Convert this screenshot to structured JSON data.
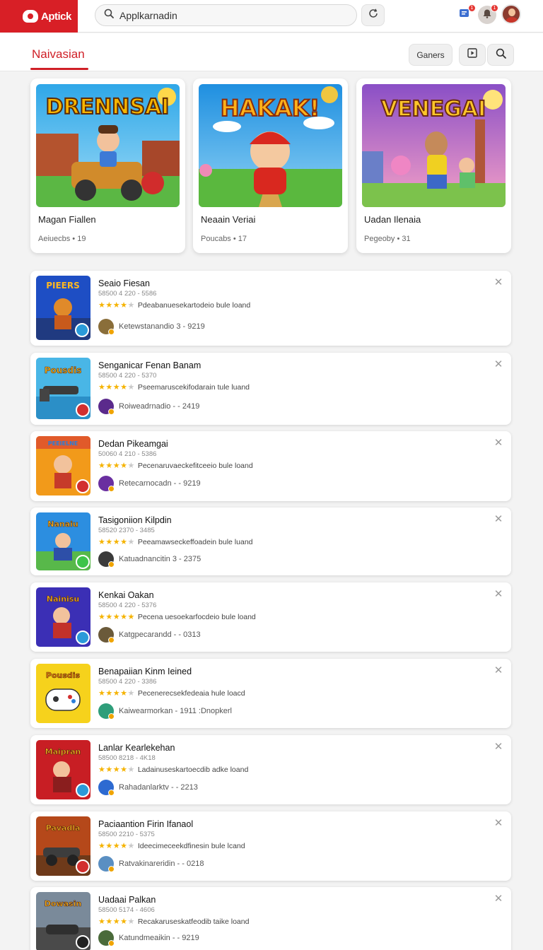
{
  "app": {
    "logo_text": "Aptick"
  },
  "search": {
    "value": "Applkarnadin",
    "placeholder": ""
  },
  "header": {
    "notif_count_1": "1",
    "notif_count_2": "1"
  },
  "section": {
    "title": "Naivasian",
    "genres_label": "Ganers"
  },
  "featured": [
    {
      "title": "Magan Fiallen",
      "meta": "Aeiuecbs • 19",
      "art_text": "DRENNSAI"
    },
    {
      "title": "Neaain Veriai",
      "meta": "Poucabs • 17",
      "art_text": "HAKAK!"
    },
    {
      "title": "Uadan Ilenaia",
      "meta": "Pegeoby • 31",
      "art_text": "VENEGAI"
    }
  ],
  "items": [
    {
      "title": "Seaio Fiesan",
      "sub": "58500 4 220 - 5586",
      "rating": 4,
      "desc": "Pdeabanuesekartodeio bule loand",
      "dev": "Ketewstanandio 3 - 9219",
      "thumb_text": "PIEERS"
    },
    {
      "title": "Senganicar Fenan Banam",
      "sub": "58500 4 220 - 5370",
      "rating": 4,
      "desc": "Pseemaruscekifodarain tule luand",
      "dev": "Roiweadrnadio - - 2419",
      "thumb_text": "Pousdis"
    },
    {
      "title": "Dedan Pikeamgai",
      "sub": "50060 4 210 - 5386",
      "rating": 4,
      "desc": "Pecenaruvaeckefitceeio bule loand",
      "dev": "Retecarnocadn - - 9219",
      "thumb_text": "PEEIELNE"
    },
    {
      "title": "Tasigoniion Kilpdin",
      "sub": "58520 2370 - 3485",
      "rating": 4,
      "desc": "Peeamawseckeffoadein bule luand",
      "dev": "Katuadnancitin 3 - 2375",
      "thumb_text": "Nanaiu"
    },
    {
      "title": "Kenkai Oakan",
      "sub": "58500 4 220 - 5376",
      "rating": 5,
      "desc": "Pecena uesoekarfocdeio bule loand",
      "dev": "Katgpecarandd - - 0313",
      "thumb_text": "Nainisu"
    },
    {
      "title": "Benapaiian Kinm Ieined",
      "sub": "58500 4 220 - 3386",
      "rating": 4,
      "desc": "Pecenerecsekfedeaia hule loacd",
      "dev": "Kaiwearmorkan - 1911 :Dnopkerl",
      "thumb_text": "Pousdis"
    },
    {
      "title": "Lanlar Kearlekehan",
      "sub": "58500 8218 - 4K18",
      "rating": 4,
      "desc": "Ladainuseskartoecdib adke loand",
      "dev": "Rahadanlarktv - - 2213",
      "thumb_text": "Maipran"
    },
    {
      "title": "Paciaantion Firin Ifanaol",
      "sub": "58500 2210 - 5375",
      "rating": 4,
      "desc": "Ideecimeceekdfinesin bule lcand",
      "dev": "Ratvakinareridin - - 0218",
      "thumb_text": "Pavadla"
    },
    {
      "title": "Uadaai Palkan",
      "sub": "58500 5174 - 4606",
      "rating": 4,
      "desc": "Recakaruseskatfeodib taike loand",
      "dev": "Katundmeaikin - - 9219",
      "thumb_text": "Dowasin"
    }
  ]
}
